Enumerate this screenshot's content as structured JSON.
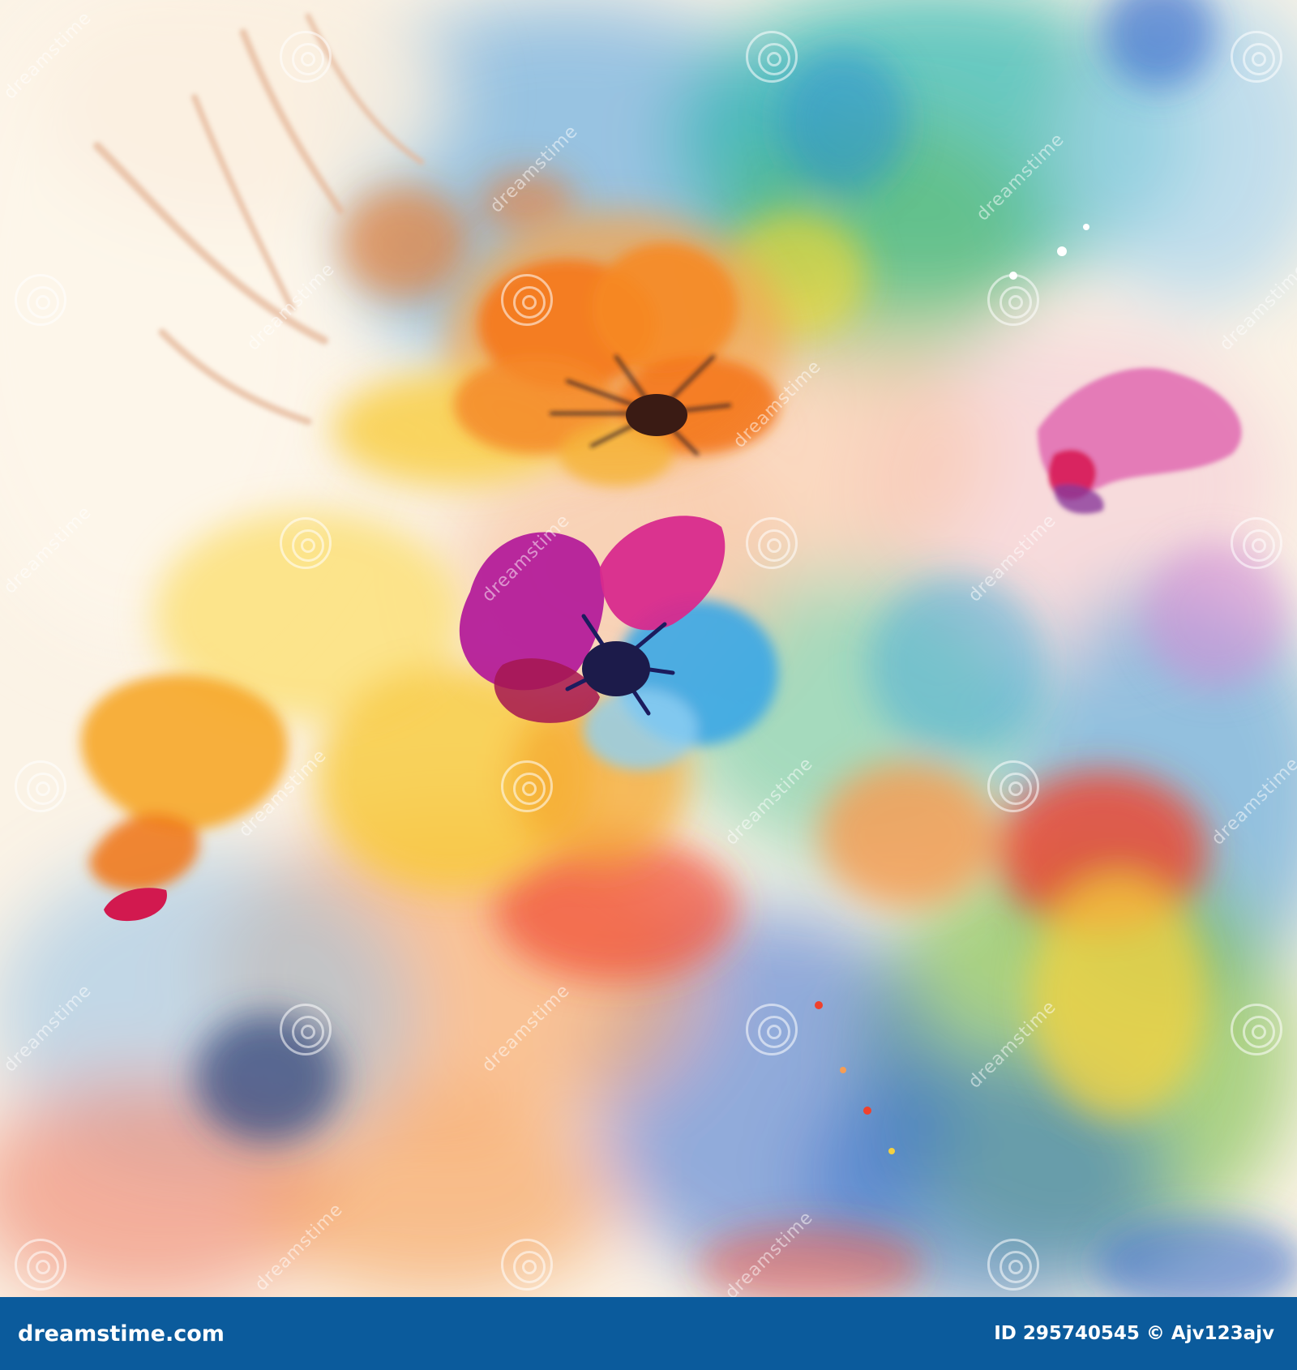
{
  "image": {
    "subject": "abstract watercolor flowers",
    "palette": {
      "orange": "#f47a1c",
      "magenta": "#c0188f",
      "pink": "#e0488a",
      "yellow": "#f8c93a",
      "sky_blue": "#3ba7e6",
      "teal": "#2bb7b0",
      "green": "#5dbb6a",
      "red": "#f0412c",
      "cream": "#fbf3e6"
    }
  },
  "watermark": {
    "text": "dreamstime"
  },
  "footer": {
    "site": "dreamstime.com",
    "id_text": "ID 295740545 © Ajv123ajv",
    "background": "#0b5b9c"
  }
}
